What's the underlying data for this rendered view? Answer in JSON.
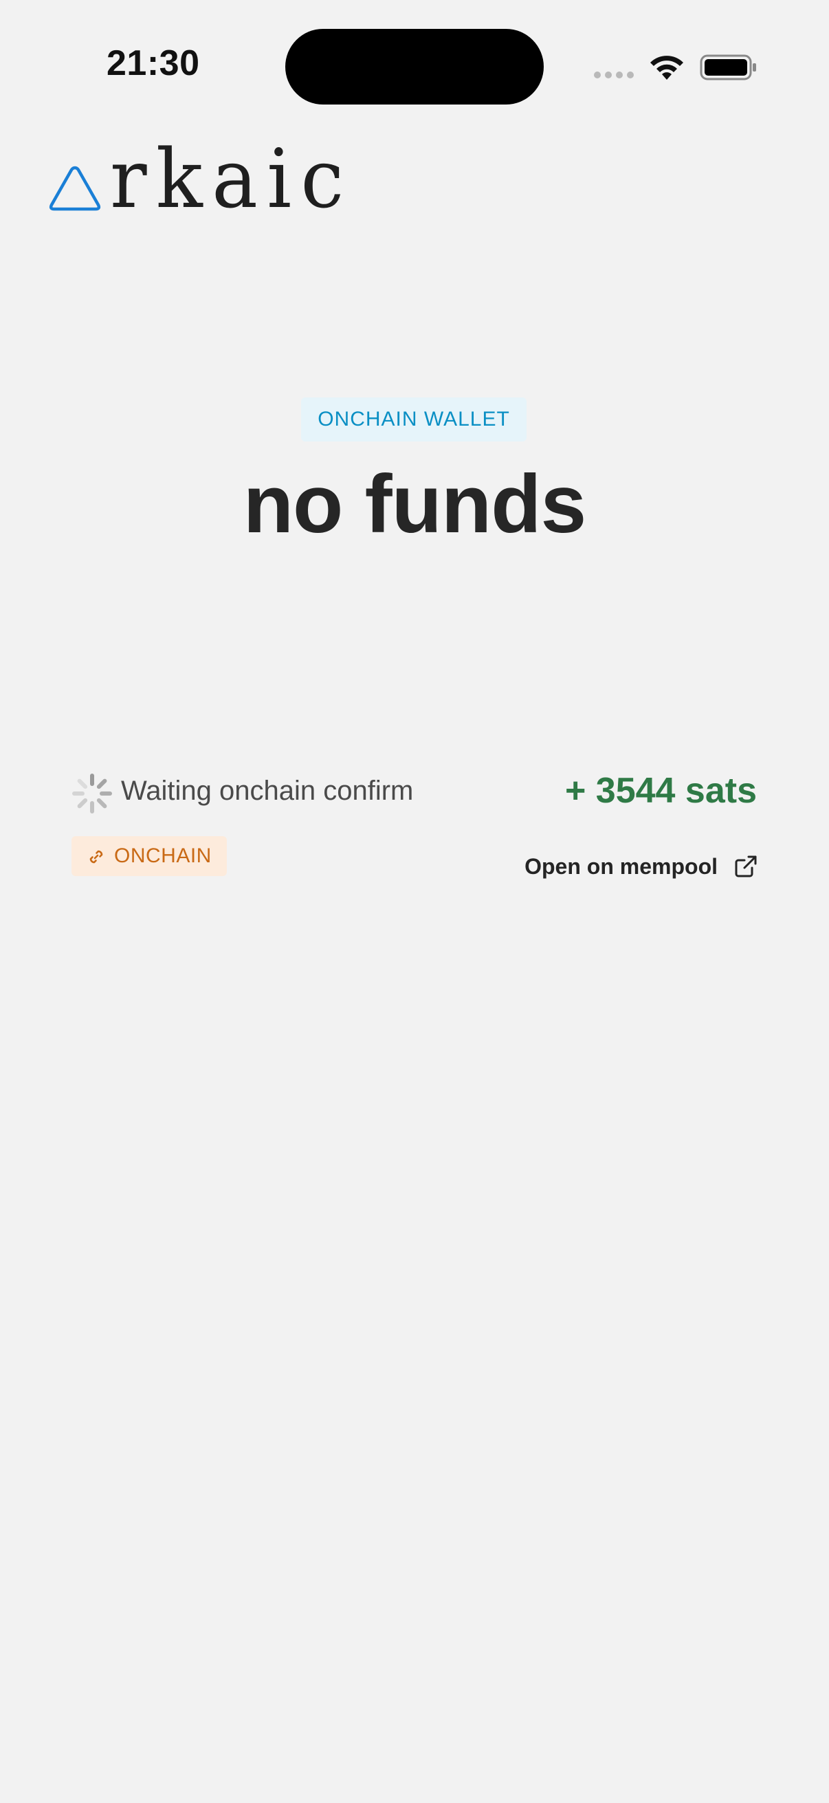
{
  "status_bar": {
    "time": "21:30",
    "icons": [
      "signal-dots-icon",
      "wifi-icon",
      "battery-icon"
    ]
  },
  "logo": {
    "text": "rkaic",
    "mark_icon": "triangle-logo-icon",
    "mark_color": "#1a7fd6"
  },
  "wallet": {
    "badge_label": "ONCHAIN WALLET",
    "balance_text": "no funds"
  },
  "transaction": {
    "status_text": "Waiting onchain confirm",
    "status_icon": "spinner-icon",
    "amount_text": "+ 3544 sats",
    "type_badge": "ONCHAIN",
    "type_icon": "link-icon",
    "link_label": "Open on mempool",
    "link_icon": "external-link-icon"
  },
  "colors": {
    "background": "#f2f2f2",
    "wallet_badge_bg": "#e6f4fa",
    "wallet_badge_text": "#0a8fc4",
    "amount_positive": "#2f7a46",
    "onchain_badge_bg": "#fdebdc",
    "onchain_badge_text": "#c96a16"
  }
}
